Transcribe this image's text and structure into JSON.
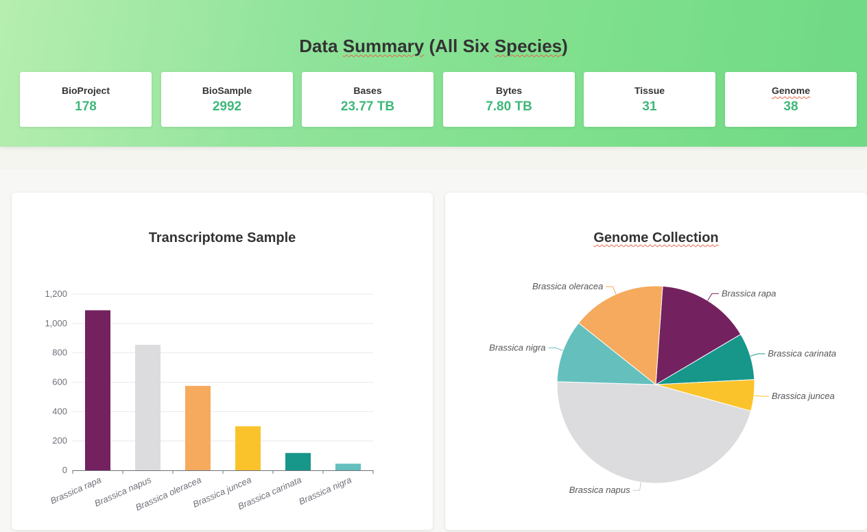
{
  "header": {
    "title_parts": [
      "Data ",
      "Summary",
      " (All Six ",
      "Species",
      ")"
    ]
  },
  "stats": [
    {
      "label": "BioProject",
      "value": "178"
    },
    {
      "label": "BioSample",
      "value": "2992"
    },
    {
      "label": "Bases",
      "value": "23.77 TB"
    },
    {
      "label": "Bytes",
      "value": "7.80 TB"
    },
    {
      "label": "Tissue",
      "value": "31"
    },
    {
      "label": "Genome",
      "value": "38"
    }
  ],
  "colors": {
    "accent_green": "#3fb77a",
    "rapa": "#74215f",
    "napus": "#dcdcde",
    "oleracea": "#f5aa5d",
    "juncea": "#fbc32b",
    "carinata": "#17968a",
    "nigra": "#64bfbd"
  },
  "chart_data": [
    {
      "type": "bar",
      "title": "Transcriptome Sample",
      "categories": [
        "Brassica rapa",
        "Brassica napus",
        "Brassica oleracea",
        "Brassica juncea",
        "Brassica carinata",
        "Brassica nigra"
      ],
      "values": [
        1090,
        855,
        575,
        300,
        118,
        45
      ],
      "colors": [
        "#74215f",
        "#dcdcde",
        "#f5aa5d",
        "#fbc32b",
        "#17968a",
        "#64bfbd"
      ],
      "y_ticks": [
        "0",
        "200",
        "400",
        "600",
        "800",
        "1,000",
        "1,200"
      ],
      "ylim": [
        0,
        1200
      ],
      "grid": true,
      "xlabel": "",
      "ylabel": ""
    },
    {
      "type": "pie",
      "title": "Genome Collection",
      "labels": [
        "Brassica rapa",
        "Brassica carinata",
        "Brassica juncea",
        "Brassica napus",
        "Brassica nigra",
        "Brassica oleracea"
      ],
      "values": [
        6,
        3,
        2,
        18,
        4,
        6
      ],
      "colors": [
        "#74215f",
        "#17968a",
        "#fbc32b",
        "#dcdcde",
        "#64bfbd",
        "#f5aa5d"
      ]
    }
  ]
}
